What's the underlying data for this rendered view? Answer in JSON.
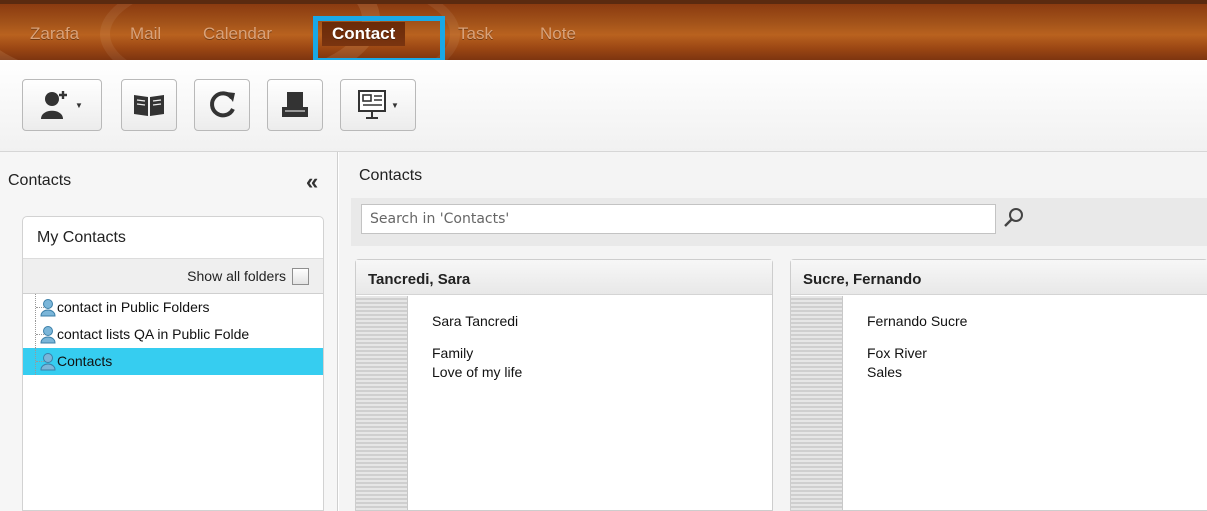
{
  "nav": {
    "tabs": [
      {
        "label": "Zarafa"
      },
      {
        "label": "Mail"
      },
      {
        "label": "Calendar"
      },
      {
        "label": "Contact"
      },
      {
        "label": "Task"
      },
      {
        "label": "Note"
      }
    ],
    "active": "Contact",
    "highlight_color": "#1aa9e6"
  },
  "toolbar": {
    "buttons": [
      {
        "icon": "new-contact-icon",
        "has_dropdown": true
      },
      {
        "icon": "address-book-icon",
        "has_dropdown": false
      },
      {
        "icon": "refresh-icon",
        "has_dropdown": false
      },
      {
        "icon": "print-icon",
        "has_dropdown": false
      },
      {
        "icon": "view-switch-icon",
        "has_dropdown": true
      }
    ]
  },
  "sidebar": {
    "title": "Contacts",
    "collapse_symbol": "«",
    "box_title": "My Contacts",
    "show_all_label": "Show all folders",
    "show_all_checked": false,
    "items": [
      {
        "label": "contact in Public Folders",
        "selected": false
      },
      {
        "label": "contact lists QA in Public Folde",
        "selected": false
      },
      {
        "label": "Contacts",
        "selected": true
      }
    ],
    "selected_color": "#36cdf0"
  },
  "main": {
    "title": "Contacts",
    "search": {
      "placeholder": "Search in 'Contacts'",
      "value": ""
    },
    "cards": [
      {
        "header": "Tancredi, Sara",
        "name": "Sara Tancredi",
        "line2": "Family",
        "line3": "Love of my life"
      },
      {
        "header": "Sucre, Fernando",
        "name": "Fernando Sucre",
        "line2": "Fox River",
        "line3": "Sales"
      }
    ]
  }
}
